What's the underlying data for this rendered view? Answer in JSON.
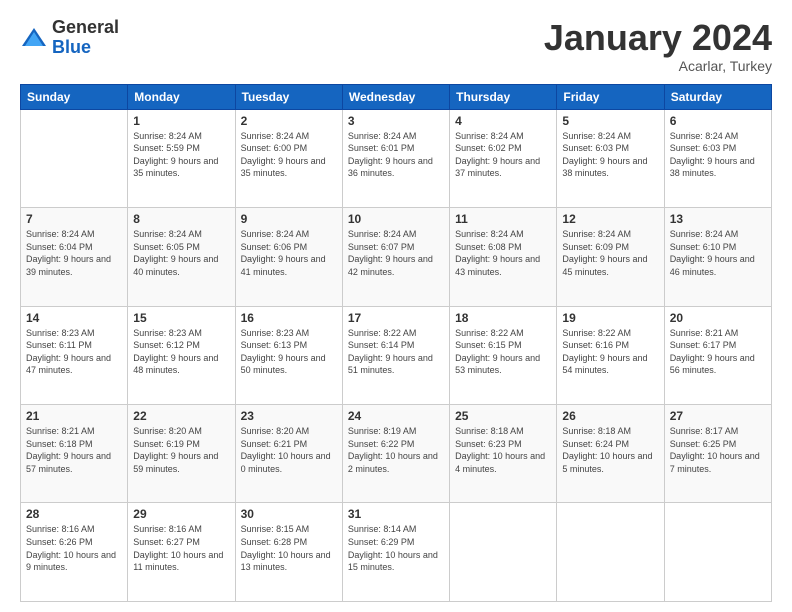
{
  "logo": {
    "general": "General",
    "blue": "Blue"
  },
  "header": {
    "month": "January 2024",
    "location": "Acarlar, Turkey"
  },
  "weekdays": [
    "Sunday",
    "Monday",
    "Tuesday",
    "Wednesday",
    "Thursday",
    "Friday",
    "Saturday"
  ],
  "weeks": [
    [
      {
        "day": "",
        "sunrise": "",
        "sunset": "",
        "daylight": ""
      },
      {
        "day": "1",
        "sunrise": "Sunrise: 8:24 AM",
        "sunset": "Sunset: 5:59 PM",
        "daylight": "Daylight: 9 hours and 35 minutes."
      },
      {
        "day": "2",
        "sunrise": "Sunrise: 8:24 AM",
        "sunset": "Sunset: 6:00 PM",
        "daylight": "Daylight: 9 hours and 35 minutes."
      },
      {
        "day": "3",
        "sunrise": "Sunrise: 8:24 AM",
        "sunset": "Sunset: 6:01 PM",
        "daylight": "Daylight: 9 hours and 36 minutes."
      },
      {
        "day": "4",
        "sunrise": "Sunrise: 8:24 AM",
        "sunset": "Sunset: 6:02 PM",
        "daylight": "Daylight: 9 hours and 37 minutes."
      },
      {
        "day": "5",
        "sunrise": "Sunrise: 8:24 AM",
        "sunset": "Sunset: 6:03 PM",
        "daylight": "Daylight: 9 hours and 38 minutes."
      },
      {
        "day": "6",
        "sunrise": "Sunrise: 8:24 AM",
        "sunset": "Sunset: 6:03 PM",
        "daylight": "Daylight: 9 hours and 38 minutes."
      }
    ],
    [
      {
        "day": "7",
        "sunrise": "Sunrise: 8:24 AM",
        "sunset": "Sunset: 6:04 PM",
        "daylight": "Daylight: 9 hours and 39 minutes."
      },
      {
        "day": "8",
        "sunrise": "Sunrise: 8:24 AM",
        "sunset": "Sunset: 6:05 PM",
        "daylight": "Daylight: 9 hours and 40 minutes."
      },
      {
        "day": "9",
        "sunrise": "Sunrise: 8:24 AM",
        "sunset": "Sunset: 6:06 PM",
        "daylight": "Daylight: 9 hours and 41 minutes."
      },
      {
        "day": "10",
        "sunrise": "Sunrise: 8:24 AM",
        "sunset": "Sunset: 6:07 PM",
        "daylight": "Daylight: 9 hours and 42 minutes."
      },
      {
        "day": "11",
        "sunrise": "Sunrise: 8:24 AM",
        "sunset": "Sunset: 6:08 PM",
        "daylight": "Daylight: 9 hours and 43 minutes."
      },
      {
        "day": "12",
        "sunrise": "Sunrise: 8:24 AM",
        "sunset": "Sunset: 6:09 PM",
        "daylight": "Daylight: 9 hours and 45 minutes."
      },
      {
        "day": "13",
        "sunrise": "Sunrise: 8:24 AM",
        "sunset": "Sunset: 6:10 PM",
        "daylight": "Daylight: 9 hours and 46 minutes."
      }
    ],
    [
      {
        "day": "14",
        "sunrise": "Sunrise: 8:23 AM",
        "sunset": "Sunset: 6:11 PM",
        "daylight": "Daylight: 9 hours and 47 minutes."
      },
      {
        "day": "15",
        "sunrise": "Sunrise: 8:23 AM",
        "sunset": "Sunset: 6:12 PM",
        "daylight": "Daylight: 9 hours and 48 minutes."
      },
      {
        "day": "16",
        "sunrise": "Sunrise: 8:23 AM",
        "sunset": "Sunset: 6:13 PM",
        "daylight": "Daylight: 9 hours and 50 minutes."
      },
      {
        "day": "17",
        "sunrise": "Sunrise: 8:22 AM",
        "sunset": "Sunset: 6:14 PM",
        "daylight": "Daylight: 9 hours and 51 minutes."
      },
      {
        "day": "18",
        "sunrise": "Sunrise: 8:22 AM",
        "sunset": "Sunset: 6:15 PM",
        "daylight": "Daylight: 9 hours and 53 minutes."
      },
      {
        "day": "19",
        "sunrise": "Sunrise: 8:22 AM",
        "sunset": "Sunset: 6:16 PM",
        "daylight": "Daylight: 9 hours and 54 minutes."
      },
      {
        "day": "20",
        "sunrise": "Sunrise: 8:21 AM",
        "sunset": "Sunset: 6:17 PM",
        "daylight": "Daylight: 9 hours and 56 minutes."
      }
    ],
    [
      {
        "day": "21",
        "sunrise": "Sunrise: 8:21 AM",
        "sunset": "Sunset: 6:18 PM",
        "daylight": "Daylight: 9 hours and 57 minutes."
      },
      {
        "day": "22",
        "sunrise": "Sunrise: 8:20 AM",
        "sunset": "Sunset: 6:19 PM",
        "daylight": "Daylight: 9 hours and 59 minutes."
      },
      {
        "day": "23",
        "sunrise": "Sunrise: 8:20 AM",
        "sunset": "Sunset: 6:21 PM",
        "daylight": "Daylight: 10 hours and 0 minutes."
      },
      {
        "day": "24",
        "sunrise": "Sunrise: 8:19 AM",
        "sunset": "Sunset: 6:22 PM",
        "daylight": "Daylight: 10 hours and 2 minutes."
      },
      {
        "day": "25",
        "sunrise": "Sunrise: 8:18 AM",
        "sunset": "Sunset: 6:23 PM",
        "daylight": "Daylight: 10 hours and 4 minutes."
      },
      {
        "day": "26",
        "sunrise": "Sunrise: 8:18 AM",
        "sunset": "Sunset: 6:24 PM",
        "daylight": "Daylight: 10 hours and 5 minutes."
      },
      {
        "day": "27",
        "sunrise": "Sunrise: 8:17 AM",
        "sunset": "Sunset: 6:25 PM",
        "daylight": "Daylight: 10 hours and 7 minutes."
      }
    ],
    [
      {
        "day": "28",
        "sunrise": "Sunrise: 8:16 AM",
        "sunset": "Sunset: 6:26 PM",
        "daylight": "Daylight: 10 hours and 9 minutes."
      },
      {
        "day": "29",
        "sunrise": "Sunrise: 8:16 AM",
        "sunset": "Sunset: 6:27 PM",
        "daylight": "Daylight: 10 hours and 11 minutes."
      },
      {
        "day": "30",
        "sunrise": "Sunrise: 8:15 AM",
        "sunset": "Sunset: 6:28 PM",
        "daylight": "Daylight: 10 hours and 13 minutes."
      },
      {
        "day": "31",
        "sunrise": "Sunrise: 8:14 AM",
        "sunset": "Sunset: 6:29 PM",
        "daylight": "Daylight: 10 hours and 15 minutes."
      },
      {
        "day": "",
        "sunrise": "",
        "sunset": "",
        "daylight": ""
      },
      {
        "day": "",
        "sunrise": "",
        "sunset": "",
        "daylight": ""
      },
      {
        "day": "",
        "sunrise": "",
        "sunset": "",
        "daylight": ""
      }
    ]
  ]
}
